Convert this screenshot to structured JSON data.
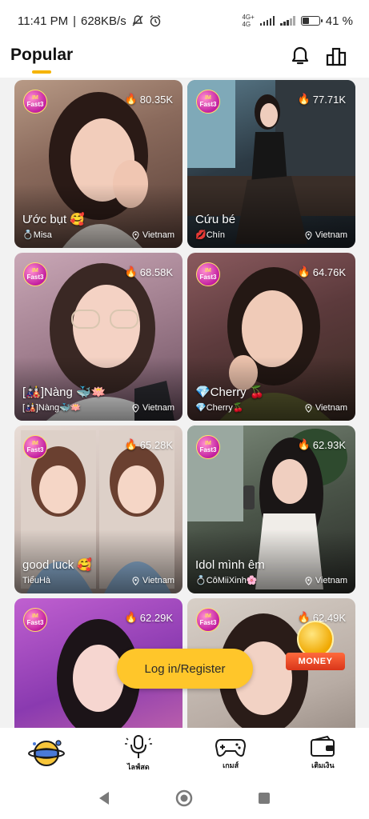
{
  "status_bar": {
    "time": "11:41 PM",
    "separator": "|",
    "speed": "628KB/s",
    "network_badge_top": "4G+",
    "network_badge_bottom": "4G",
    "battery_percent": "41",
    "battery_symbol": "%",
    "battery_level": 0.41
  },
  "header": {
    "tab_popular": "Popular",
    "accent": "#f5b400"
  },
  "streams": [
    {
      "badge_top": "IM",
      "badge_bottom": "Fast3",
      "viewers": "80.35K",
      "title": "Ước bụt 🥰",
      "host": "Misa",
      "host_prefix": "💍",
      "location": "Vietnam"
    },
    {
      "badge_top": "IM",
      "badge_bottom": "Fast3",
      "viewers": "77.71K",
      "title": "Cứu bé",
      "host": "Chín",
      "host_prefix": "💋",
      "location": "Vietnam"
    },
    {
      "badge_top": "IM",
      "badge_bottom": "Fast3",
      "viewers": "68.58K",
      "title": "[🎎]Nàng 🐳🪷",
      "host": "[🎎]Nàng🐳🪷",
      "host_prefix": "",
      "location": "Vietnam"
    },
    {
      "badge_top": "IM",
      "badge_bottom": "Fast3",
      "viewers": "64.76K",
      "title": "💎Cherry 🍒",
      "host": "Cherry🍒",
      "host_prefix": "💎",
      "location": "Vietnam"
    },
    {
      "badge_top": "IM",
      "badge_bottom": "Fast3",
      "viewers": "65.28K",
      "title": "good luck 🥰",
      "host": "TiểuHà",
      "host_prefix": "",
      "location": "Vietnam"
    },
    {
      "badge_top": "IM",
      "badge_bottom": "Fast3",
      "viewers": "62.93K",
      "title": "Idol mình êm",
      "host": "CôMiiXinh🌸",
      "host_prefix": "💍",
      "location": "Vietnam"
    },
    {
      "badge_top": "IM",
      "badge_bottom": "Fast3",
      "viewers": "62.29K",
      "title": "",
      "host": "",
      "host_prefix": "",
      "location": ""
    },
    {
      "badge_top": "IM",
      "badge_bottom": "Fast3",
      "viewers": "62.49K",
      "title": "",
      "host": "",
      "host_prefix": "",
      "location": ""
    }
  ],
  "login_button": "Log in/Register",
  "money_promo": "MONEY",
  "bottom_nav": {
    "items": [
      {
        "icon": "planet-home-icon",
        "label": ""
      },
      {
        "icon": "microphone-live-icon",
        "label": "ไลฟ์สด"
      },
      {
        "icon": "gamepad-icon",
        "label": "เกมส์"
      },
      {
        "icon": "wallet-icon",
        "label": "เติมเงิน"
      }
    ]
  },
  "colors": {
    "login_button": "#ffc62a",
    "flame": "#ff6a00",
    "badge": "#c21fa0"
  }
}
